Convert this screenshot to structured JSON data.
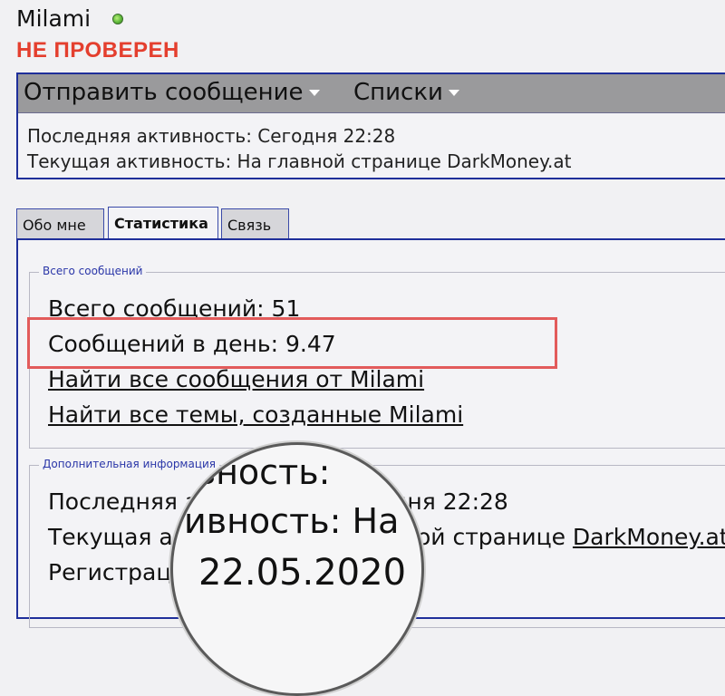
{
  "profile": {
    "username": "Milami",
    "status": "НЕ ПРОВЕРЕН",
    "menu": {
      "send_message": "Отправить сообщение",
      "lists": "Списки"
    },
    "last_activity": "Последняя активность: Сегодня 22:28",
    "current_activity": "Текущая активность: На главной странице DarkMoney.at"
  },
  "tabs": {
    "about": "Обо мне",
    "stats": "Статистика",
    "contact": "Связь"
  },
  "stats": {
    "legend": "Всего сообщений",
    "total_posts": "Всего сообщений: 51",
    "posts_per_day": "Сообщений в день: 9.47",
    "find_posts": "Найти все сообщения от Milami",
    "find_threads": "Найти все темы, созданные Milami"
  },
  "extra": {
    "legend": "Дополнительная информация",
    "last_activity": "Последняя активность: Сегодня 22:28",
    "current_activity_prefix": "Текущая активность: На главной странице ",
    "current_activity_link": "DarkMoney.at",
    "registration": "Регистрация: 22.05.2020"
  },
  "magnifier": {
    "line1": "ивность:",
    "line2": "ивность: На",
    "line3": "22.05.2020"
  },
  "colors": {
    "status_red": "#e43f2e",
    "border_blue": "#1f2f9a",
    "highlight_red": "#e25b5b",
    "online_green": "#5fb93a"
  }
}
